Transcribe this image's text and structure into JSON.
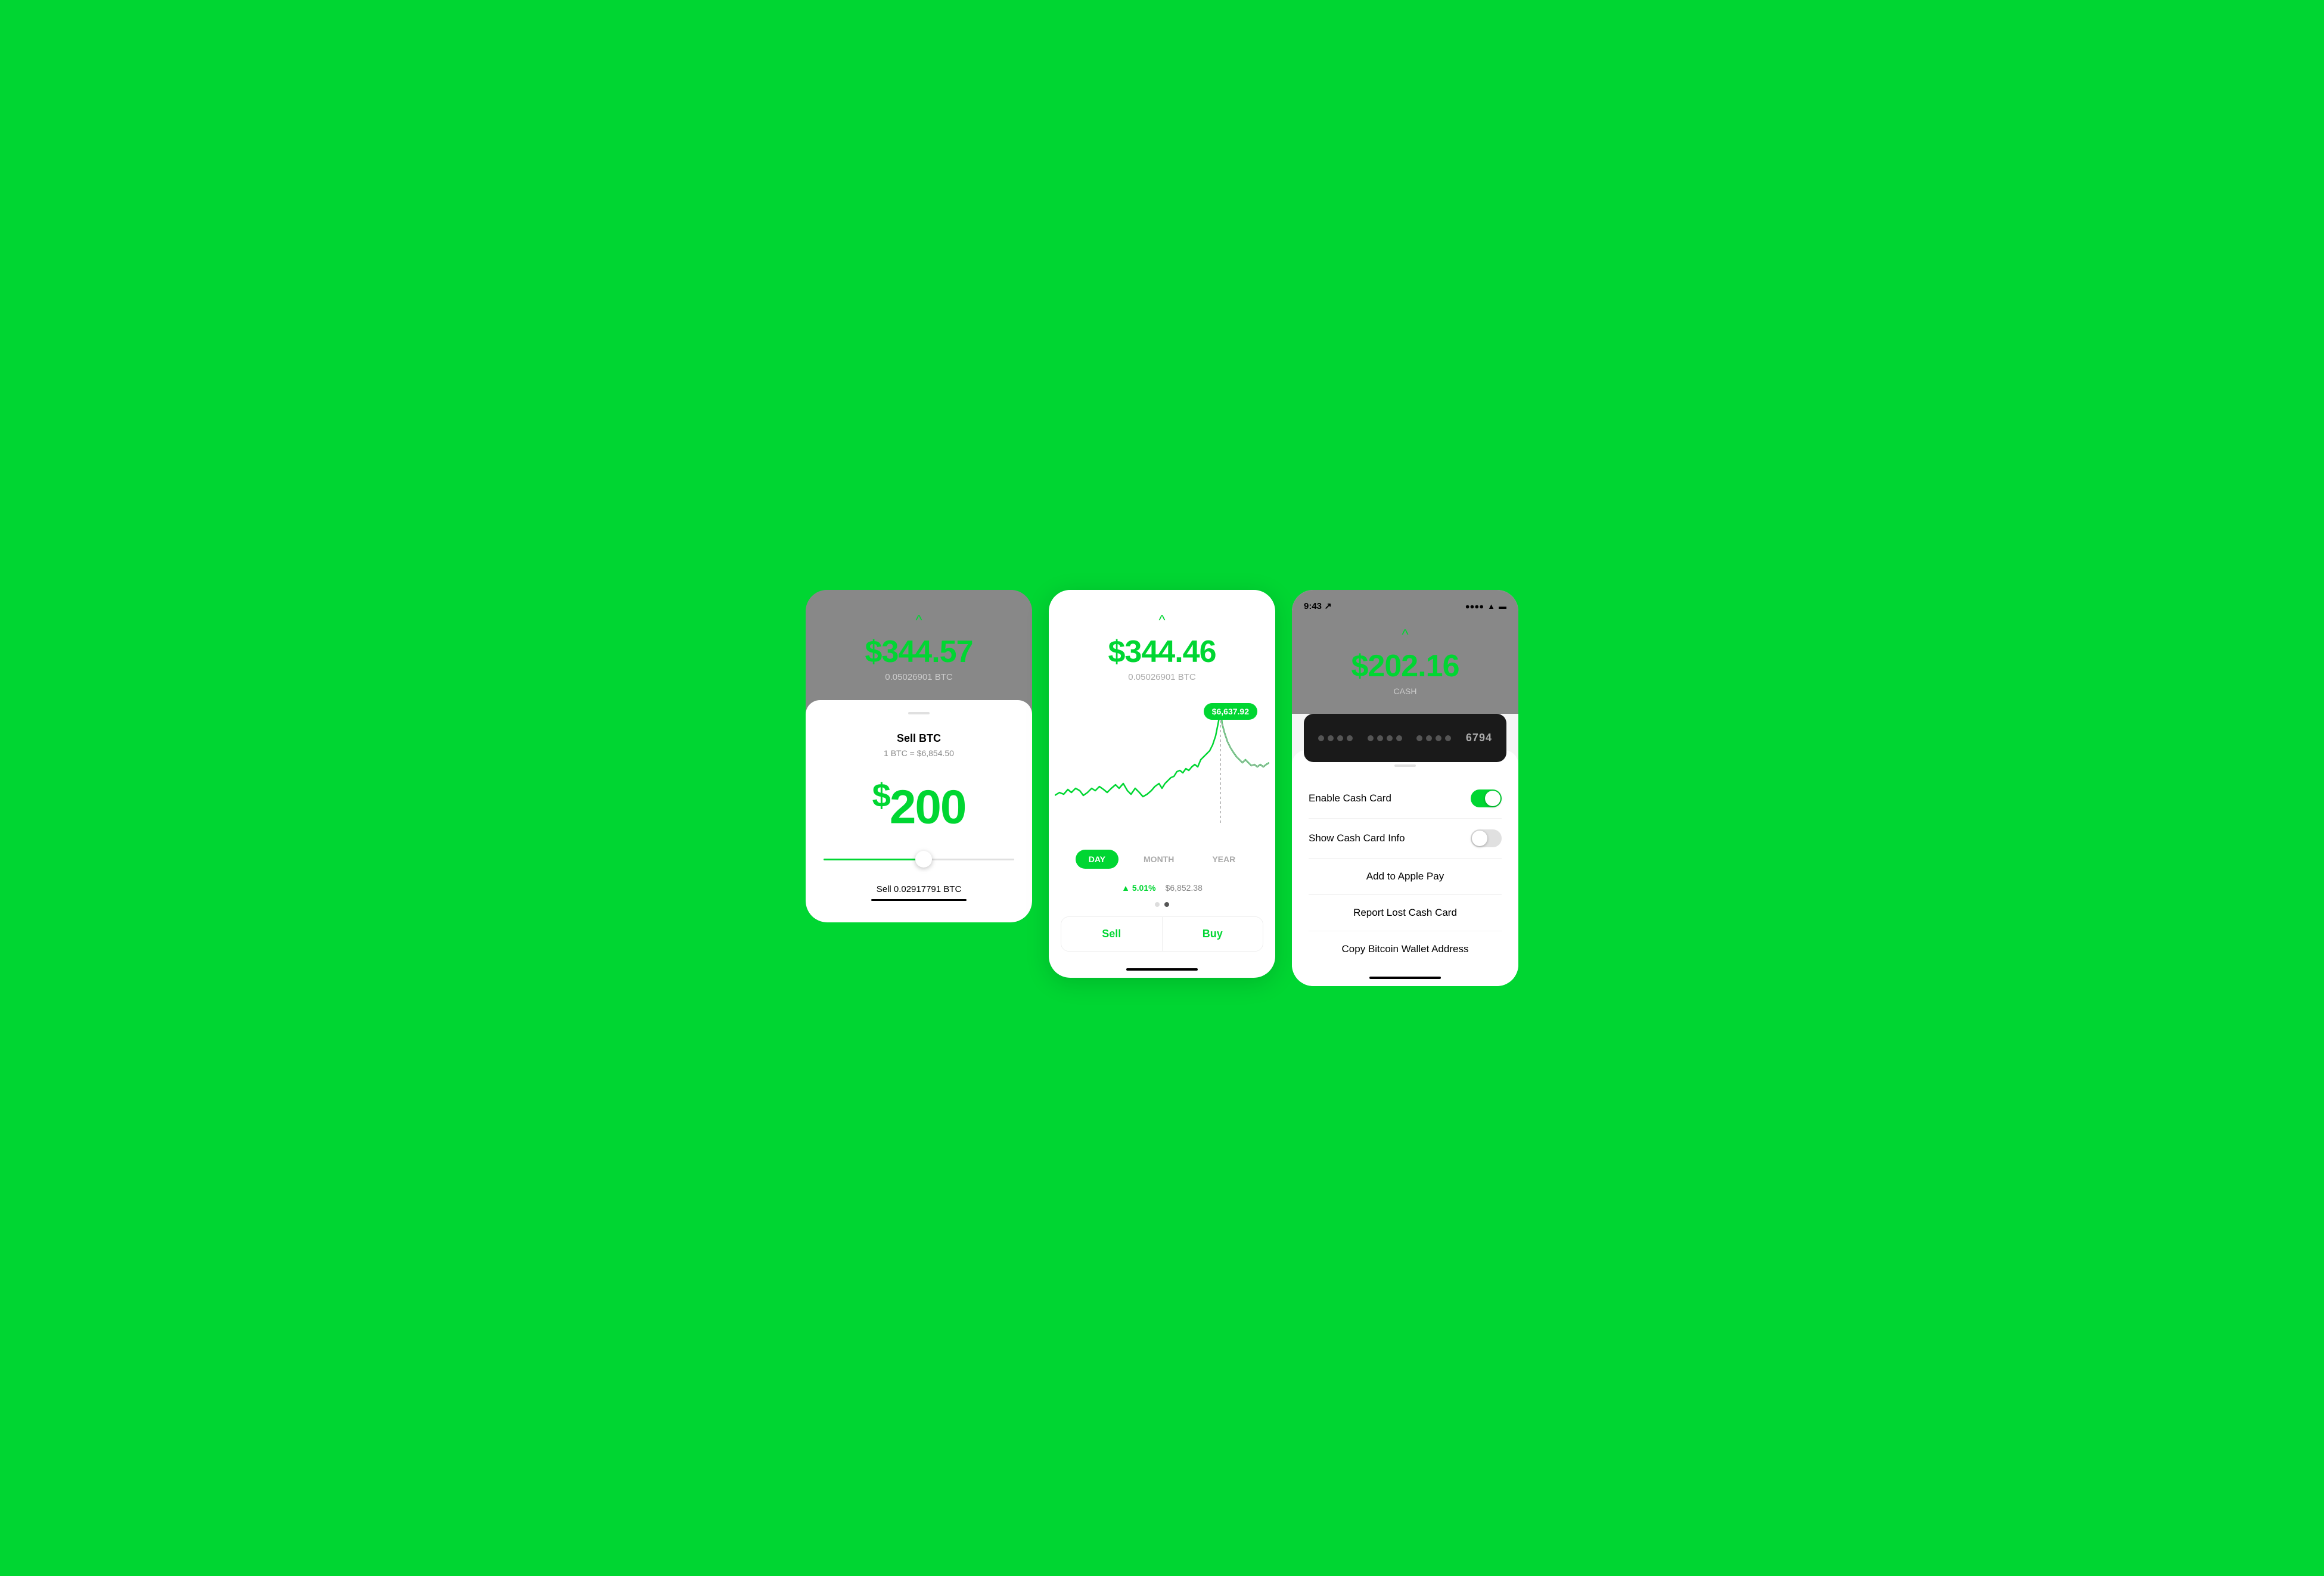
{
  "screen1": {
    "chevron": "^",
    "btc_price": "$344.57",
    "btc_amount": "0.05026901 BTC",
    "title": "Sell BTC",
    "rate": "1 BTC = $6,854.50",
    "amount": "$200",
    "sell_label": "Sell 0.02917791 BTC"
  },
  "screen2": {
    "chevron": "^",
    "btc_price": "$344.46",
    "btc_amount": "0.05026901 BTC",
    "tooltip_price": "$6,637.92",
    "time_options": [
      "DAY",
      "MONTH",
      "YEAR"
    ],
    "active_time": "DAY",
    "stat_percent": "▲ 5.01%",
    "stat_price": "$6,852.38",
    "sell_label": "Sell",
    "buy_label": "Buy"
  },
  "screen3": {
    "status_time": "9:43",
    "status_arrow": "↗",
    "chevron": "^",
    "cash_amount": "$202.16",
    "cash_label": "CASH",
    "card_last4": "6794",
    "enable_label": "Enable Cash Card",
    "show_info_label": "Show Cash Card Info",
    "apple_pay_label": "Add to Apple Pay",
    "report_lost_label": "Report Lost Cash Card",
    "copy_bitcoin_label": "Copy Bitcoin Wallet Address"
  },
  "colors": {
    "green": "#00d632",
    "dark_green": "#00b52c"
  }
}
